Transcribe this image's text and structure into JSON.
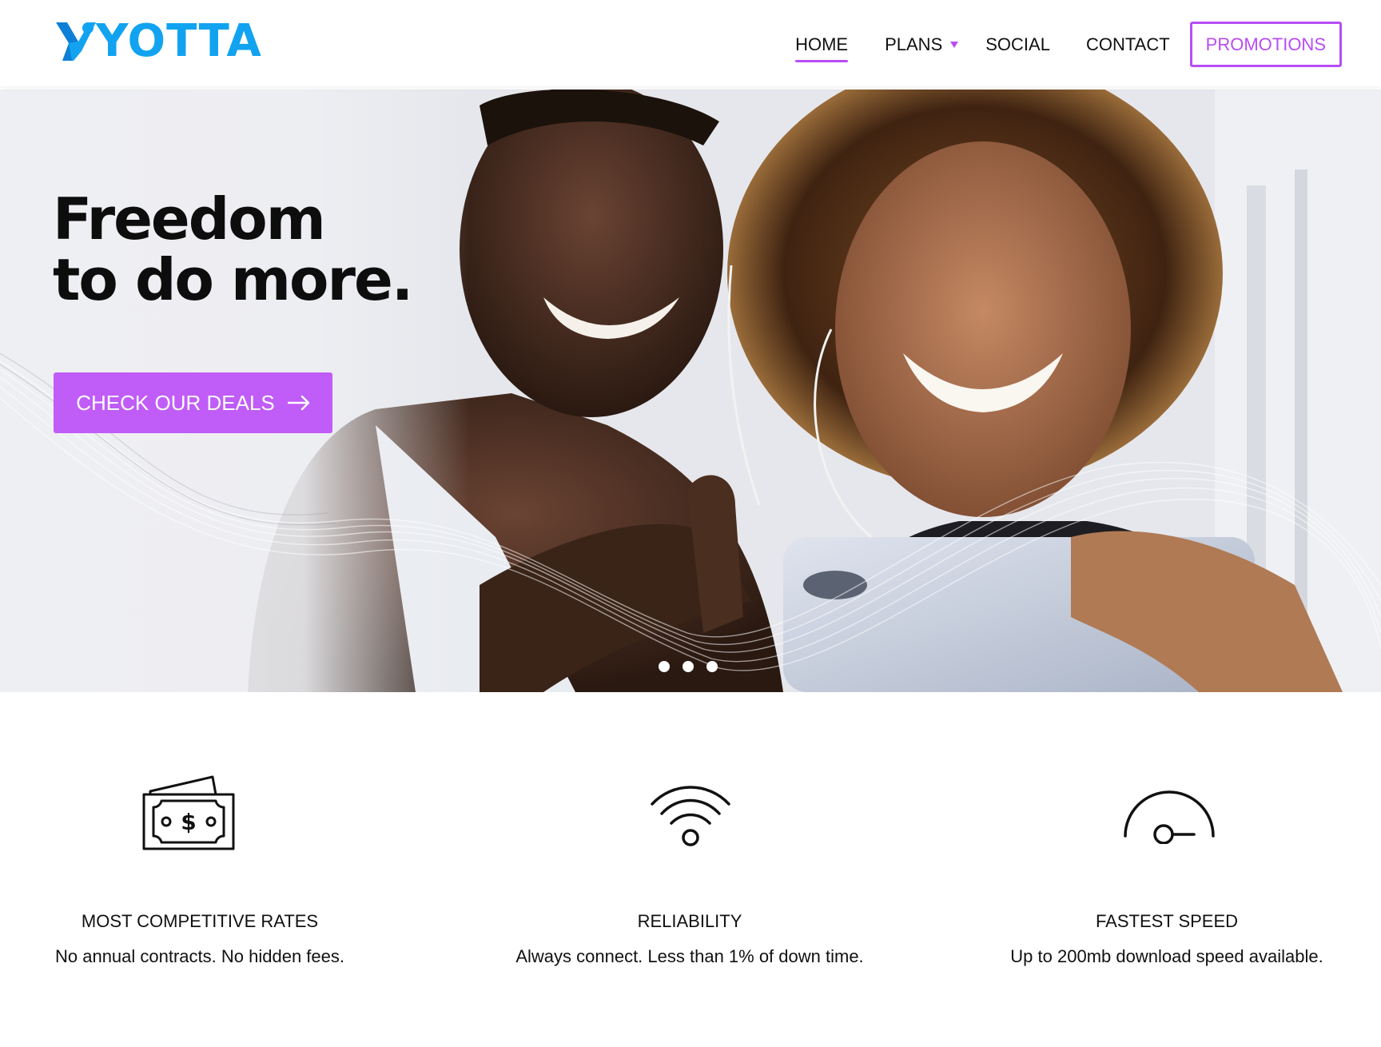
{
  "brand": {
    "name": "YOTTA",
    "accent": "#b84cf5",
    "logo_color": "#12a3f0"
  },
  "nav": {
    "items": [
      {
        "label": "HOME",
        "active": true
      },
      {
        "label": "PLANS",
        "has_dropdown": true
      },
      {
        "label": "SOCIAL"
      },
      {
        "label": "CONTACT"
      }
    ],
    "promo_label": "PROMOTIONS"
  },
  "hero": {
    "title_line1": "Freedom",
    "title_line2": "to do more.",
    "cta_label": "CHECK OUR DEALS",
    "cta_icon": "arrow-right-icon",
    "cta_color": "#c05cf7",
    "slides_count": 3
  },
  "features": [
    {
      "icon": "money-bill-icon",
      "title": "MOST COMPETITIVE RATES",
      "desc": "No annual contracts. No hidden fees."
    },
    {
      "icon": "wifi-icon",
      "title": "RELIABILITY",
      "desc": "Always connect. Less than 1% of down time."
    },
    {
      "icon": "speedometer-icon",
      "title": "FASTEST SPEED",
      "desc": "Up to 200mb download speed available."
    }
  ]
}
